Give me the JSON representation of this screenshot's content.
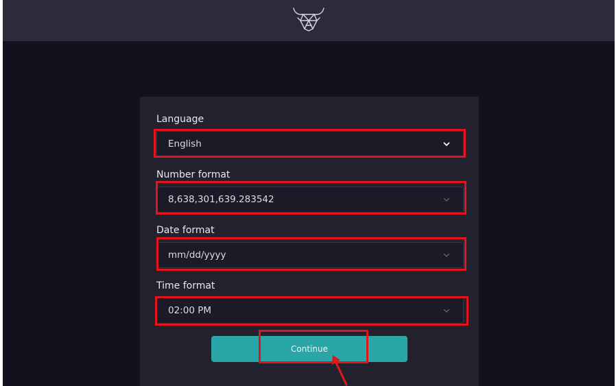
{
  "header": {
    "logo_icon": "bull-head-icon"
  },
  "form": {
    "language": {
      "label": "Language",
      "value": "English"
    },
    "number_format": {
      "label": "Number format",
      "value": "8,638,301,639.283542"
    },
    "date_format": {
      "label": "Date format",
      "value": "mm/dd/yyyy"
    },
    "time_format": {
      "label": "Time format",
      "value": "02:00 PM"
    },
    "continue_label": "Continue"
  },
  "colors": {
    "background": "#12121f",
    "topbar": "#2b2b3b",
    "panel": "#22222f",
    "field": "#1b1b27",
    "accent": "#2aa6a6",
    "highlight": "#e4141c"
  },
  "icons": {
    "dropdown": "chevron-down-icon",
    "annotation": "arrow-icon"
  }
}
